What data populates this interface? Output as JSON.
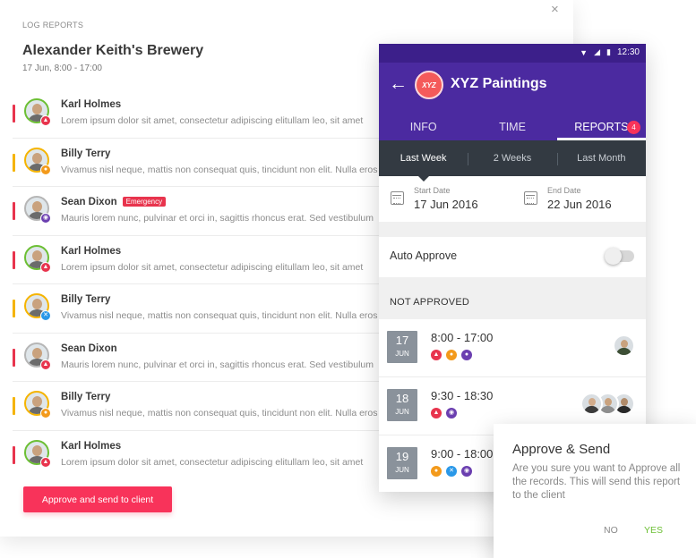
{
  "log": {
    "label": "LOG REPORTS",
    "title": "Alexander Keith's Brewery",
    "subtitle": "17 Jun, 8:00 - 17:00",
    "close_icon": "×",
    "approve_button": "Approve and send  to client",
    "entries": [
      {
        "name": "Karl Holmes",
        "tag": "",
        "text": "Lorem ipsum dolor sit amet, consectetur adipiscing elitullam leo, sit amet",
        "bar_color": "#e8344d",
        "ring_color": "#6cbf34",
        "badge": "warning",
        "badge_color": "#e8344d",
        "badge_glyph": "▲"
      },
      {
        "name": "Billy Terry",
        "tag": "",
        "text": "Vivamus nisl neque, mattis non consequat quis, tincidunt non elit. Nulla eros",
        "bar_color": "#f5b400",
        "ring_color": "#f5b400",
        "badge": "person",
        "badge_color": "#f39a1b",
        "badge_glyph": "●"
      },
      {
        "name": "Sean Dixon",
        "tag": "Emergency",
        "text": "Mauris lorem nunc, pulvinar et orci in, sagittis rhoncus erat. Sed vestibulum",
        "bar_color": "#e8344d",
        "ring_color": "#b6b6b6",
        "badge": "target",
        "badge_color": "#6b3fb0",
        "badge_glyph": "◉"
      },
      {
        "name": "Karl Holmes",
        "tag": "",
        "text": "Lorem ipsum dolor sit amet, consectetur adipiscing elitullam leo, sit amet",
        "bar_color": "#e8344d",
        "ring_color": "#6cbf34",
        "badge": "warning",
        "badge_color": "#e8344d",
        "badge_glyph": "▲"
      },
      {
        "name": "Billy Terry",
        "tag": "",
        "text": "Vivamus nisl neque, mattis non consequat quis, tincidunt non elit. Nulla eros",
        "bar_color": "#f5b400",
        "ring_color": "#f5b400",
        "badge": "tools",
        "badge_color": "#2a98e8",
        "badge_glyph": "✕"
      },
      {
        "name": "Sean Dixon",
        "tag": "",
        "text": "Mauris lorem nunc, pulvinar et orci in, sagittis rhoncus erat. Sed vestibulum",
        "bar_color": "#e8344d",
        "ring_color": "#b6b6b6",
        "badge": "warning",
        "badge_color": "#e8344d",
        "badge_glyph": "▲"
      },
      {
        "name": "Billy Terry",
        "tag": "",
        "text": "Vivamus nisl neque, mattis non consequat quis, tincidunt non elit. Nulla eros",
        "bar_color": "#f5b400",
        "ring_color": "#f5b400",
        "badge": "person",
        "badge_color": "#f39a1b",
        "badge_glyph": "●"
      },
      {
        "name": "Karl Holmes",
        "tag": "",
        "text": "Lorem ipsum dolor sit amet, consectetur adipiscing elitullam leo, sit amet",
        "bar_color": "#e8344d",
        "ring_color": "#6cbf34",
        "badge": "warning",
        "badge_color": "#e8344d",
        "badge_glyph": "▲"
      }
    ]
  },
  "phone": {
    "status_time": "12:30",
    "app_title": "XYZ Paintings",
    "logo_text": "XYZ",
    "tabs": [
      {
        "label": "INFO",
        "badge": ""
      },
      {
        "label": "TIME",
        "badge": ""
      },
      {
        "label": "REPORTS",
        "badge": "4"
      }
    ],
    "ranges": [
      "Last Week",
      "2 Weeks",
      "Last Month"
    ],
    "start_date": {
      "label": "Start Date",
      "value": "17 Jun 2016"
    },
    "end_date": {
      "label": "End Date",
      "value": "22 Jun 2016"
    },
    "auto_approve": {
      "label": "Auto Approve",
      "enabled": false
    },
    "section_title": "NOT APPROVED",
    "records": [
      {
        "day": "17",
        "month": "JUN",
        "time": "8:00 - 17:00",
        "icons": [
          {
            "name": "warning",
            "color": "#e8344d",
            "glyph": "▲"
          },
          {
            "name": "person",
            "color": "#f39a1b",
            "glyph": "●"
          },
          {
            "name": "worker",
            "color": "#6b3fb0",
            "glyph": "●"
          }
        ],
        "avatars": [
          {
            "skin": "#c9a27e",
            "shirt": "#3d4f35"
          }
        ]
      },
      {
        "day": "18",
        "month": "JUN",
        "time": "9:30 - 18:30",
        "icons": [
          {
            "name": "warning",
            "color": "#e8344d",
            "glyph": "▲"
          },
          {
            "name": "target",
            "color": "#6b3fb0",
            "glyph": "◉"
          }
        ],
        "avatars": [
          {
            "skin": "#b08b6a",
            "shirt": "#2a2a2a"
          },
          {
            "skin": "#c9a27e",
            "shirt": "#8f8f8f"
          },
          {
            "skin": "#d1ab8b",
            "shirt": "#3c3c3c"
          }
        ]
      },
      {
        "day": "19",
        "month": "JUN",
        "time": "9:00 - 18:00",
        "icons": [
          {
            "name": "person",
            "color": "#f39a1b",
            "glyph": "●"
          },
          {
            "name": "tools",
            "color": "#2a98e8",
            "glyph": "✕"
          },
          {
            "name": "target",
            "color": "#6b3fb0",
            "glyph": "◉"
          }
        ],
        "avatars": []
      }
    ]
  },
  "dialog": {
    "title": "Approve & Send",
    "text": "Are you sure you want to Approve all the records. This will send this report to the client",
    "no": "NO",
    "yes": "YES"
  },
  "colors": {
    "accent_pink": "#f8335a",
    "phone_purple": "#4b2aa0",
    "status_purple": "#3c1f8a",
    "range_dark": "#333a42",
    "yes_green": "#6cbf34"
  }
}
